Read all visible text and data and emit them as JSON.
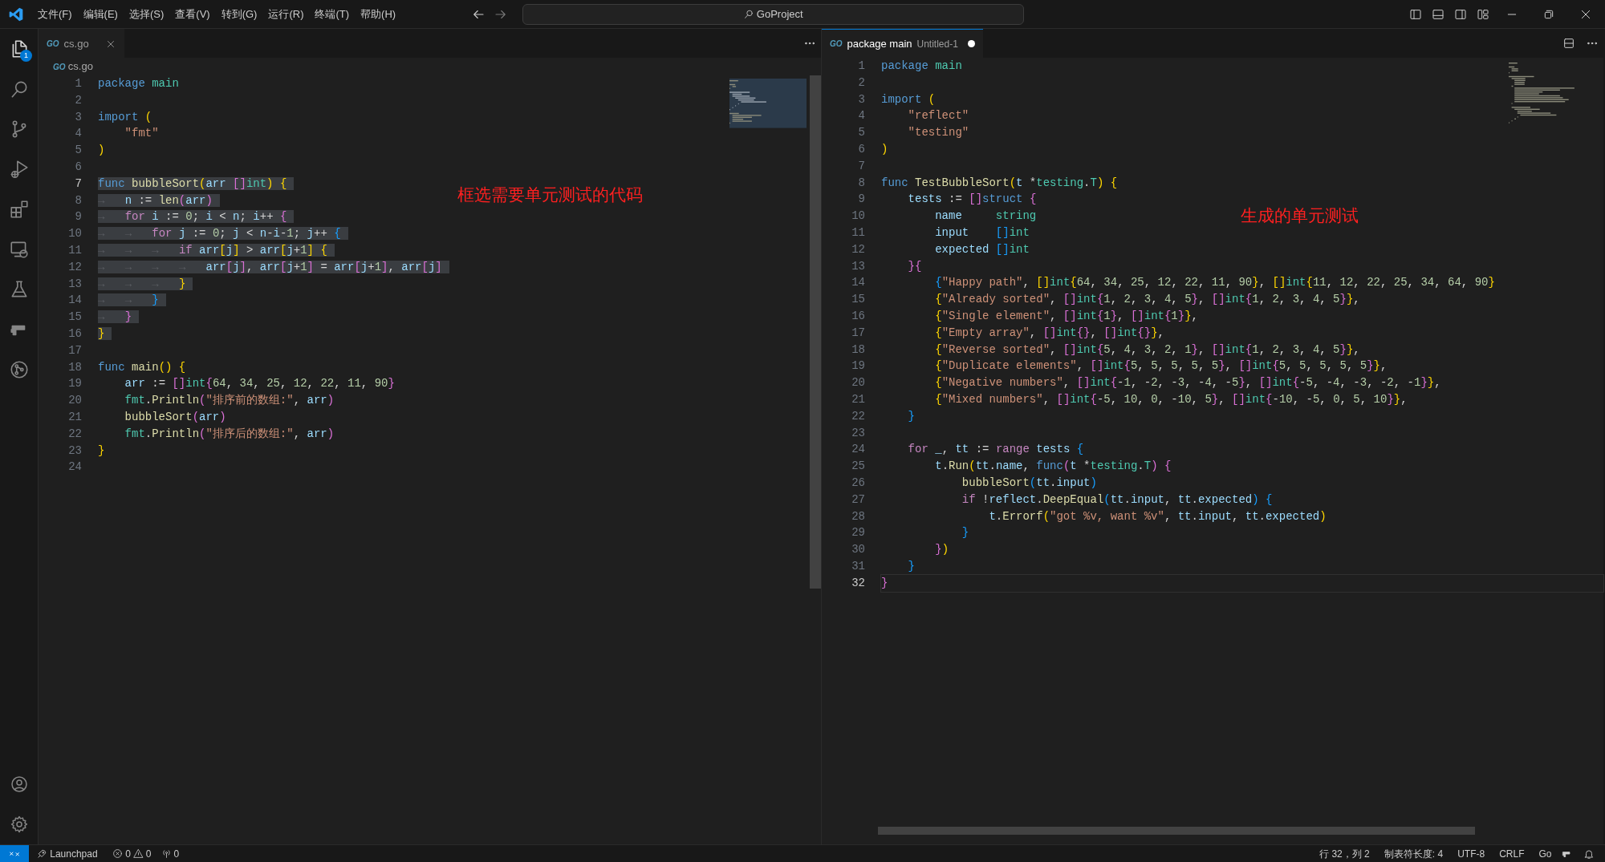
{
  "title_bar": {
    "menus": [
      "文件(F)",
      "编辑(E)",
      "选择(S)",
      "查看(V)",
      "转到(G)",
      "运行(R)",
      "终端(T)",
      "帮助(H)"
    ],
    "search": "GoProject"
  },
  "activity_bar": {
    "explorer_badge": "1"
  },
  "editors": [
    {
      "focused": false,
      "tab": {
        "icon": "GO",
        "label": "cs.go",
        "dirty": false
      },
      "breadcrumb": {
        "icon": "GO",
        "label": "cs.go"
      },
      "annotation": "框选需要单元测试的代码",
      "lines": [
        {
          "n": "1",
          "text": "package main",
          "selected": false,
          "current": false
        },
        {
          "n": "2",
          "current": false
        },
        {
          "n": "3",
          "text": "import (",
          "selected": false,
          "current": false
        },
        {
          "n": "4",
          "text": "    \"fmt\"",
          "selected": false,
          "current": false
        },
        {
          "n": "5",
          "text": ")",
          "selected": false,
          "current": false
        },
        {
          "n": "6",
          "current": false
        },
        {
          "n": "7",
          "text": "func bubbleSort(arr []int) {",
          "selected": true,
          "current": true
        },
        {
          "n": "8",
          "text": "→   n := len(arr)",
          "selected": true,
          "current": false
        },
        {
          "n": "9",
          "text": "→   for i := 0; i < n; i++ {",
          "selected": true,
          "current": false
        },
        {
          "n": "10",
          "text": "→   →   for j := 0; j < n-i-1; j++ {",
          "selected": true,
          "current": false
        },
        {
          "n": "11",
          "text": "→   →   →   if arr[j] > arr[j+1] {",
          "selected": true,
          "current": false
        },
        {
          "n": "12",
          "text": "→   →   →   →   arr[j], arr[j+1] = arr[j+1], arr[j]",
          "selected": true,
          "current": false
        },
        {
          "n": "13",
          "text": "→   →   →   }",
          "selected": true,
          "current": false
        },
        {
          "n": "14",
          "text": "→   →   }",
          "selected": true,
          "current": false
        },
        {
          "n": "15",
          "text": "→   }",
          "selected": true,
          "current": false
        },
        {
          "n": "16",
          "text": "}",
          "selected": true,
          "current": false
        },
        {
          "n": "17",
          "current": false
        },
        {
          "n": "18",
          "text": "func main() {",
          "selected": false,
          "current": false
        },
        {
          "n": "19",
          "text": "    arr := []int{64, 34, 25, 12, 22, 11, 90}",
          "selected": false,
          "current": false
        },
        {
          "n": "20",
          "text": "    fmt.Println(\"排序前的数组:\", arr)",
          "selected": false,
          "current": false
        },
        {
          "n": "21",
          "text": "    bubbleSort(arr)",
          "selected": false,
          "current": false
        },
        {
          "n": "22",
          "text": "    fmt.Println(\"排序后的数组:\", arr)",
          "selected": false,
          "current": false
        },
        {
          "n": "23",
          "text": "}",
          "selected": false,
          "current": false
        },
        {
          "n": "24",
          "current": false
        }
      ]
    },
    {
      "focused": true,
      "tab": {
        "icon": "GO",
        "label": "package main",
        "description": "Untitled-1",
        "dirty": true
      },
      "annotation": "生成的单元测试",
      "lines": [
        {
          "n": "1",
          "text": "package main",
          "selected": false,
          "current": false
        },
        {
          "n": "2",
          "current": false
        },
        {
          "n": "3",
          "text": "import (",
          "selected": false,
          "current": false
        },
        {
          "n": "4",
          "text": "    \"reflect\"",
          "selected": false,
          "current": false
        },
        {
          "n": "5",
          "text": "    \"testing\"",
          "selected": false,
          "current": false
        },
        {
          "n": "6",
          "text": ")",
          "selected": false,
          "current": false
        },
        {
          "n": "7",
          "current": false
        },
        {
          "n": "8",
          "text": "func TestBubbleSort(t *testing.T) {",
          "selected": false,
          "current": false
        },
        {
          "n": "9",
          "text": "    tests := []struct {",
          "selected": false,
          "current": false
        },
        {
          "n": "10",
          "text": "        name     string",
          "selected": false,
          "current": false
        },
        {
          "n": "11",
          "text": "        input    []int",
          "selected": false,
          "current": false
        },
        {
          "n": "12",
          "text": "        expected []int",
          "selected": false,
          "current": false
        },
        {
          "n": "13",
          "text": "    }{",
          "selected": false,
          "current": false
        },
        {
          "n": "14",
          "text": "        {\"Happy path\", []int{64, 34, 25, 12, 22, 11, 90}, []int{11, 12, 22, 25, 34, 64, 90}",
          "selected": false,
          "current": false
        },
        {
          "n": "15",
          "text": "        {\"Already sorted\", []int{1, 2, 3, 4, 5}, []int{1, 2, 3, 4, 5}},",
          "selected": false,
          "current": false
        },
        {
          "n": "16",
          "text": "        {\"Single element\", []int{1}, []int{1}},",
          "selected": false,
          "current": false
        },
        {
          "n": "17",
          "text": "        {\"Empty array\", []int{}, []int{}},",
          "selected": false,
          "current": false
        },
        {
          "n": "18",
          "text": "        {\"Reverse sorted\", []int{5, 4, 3, 2, 1}, []int{1, 2, 3, 4, 5}},",
          "selected": false,
          "current": false
        },
        {
          "n": "19",
          "text": "        {\"Duplicate elements\", []int{5, 5, 5, 5, 5}, []int{5, 5, 5, 5, 5}},",
          "selected": false,
          "current": false
        },
        {
          "n": "20",
          "text": "        {\"Negative numbers\", []int{-1, -2, -3, -4, -5}, []int{-5, -4, -3, -2, -1}},",
          "selected": false,
          "current": false
        },
        {
          "n": "21",
          "text": "        {\"Mixed numbers\", []int{-5, 10, 0, -10, 5}, []int{-10, -5, 0, 5, 10}},",
          "selected": false,
          "current": false
        },
        {
          "n": "22",
          "text": "    }",
          "selected": false,
          "current": false
        },
        {
          "n": "23",
          "current": false
        },
        {
          "n": "24",
          "text": "    for _, tt := range tests {",
          "selected": false,
          "current": false
        },
        {
          "n": "25",
          "text": "        t.Run(tt.name, func(t *testing.T) {",
          "selected": false,
          "current": false
        },
        {
          "n": "26",
          "text": "            bubbleSort(tt.input)",
          "selected": false,
          "current": false
        },
        {
          "n": "27",
          "text": "            if !reflect.DeepEqual(tt.input, tt.expected) {",
          "selected": false,
          "current": false
        },
        {
          "n": "28",
          "text": "                t.Errorf(\"got %v, want %v\", tt.input, tt.expected)",
          "selected": false,
          "current": false
        },
        {
          "n": "29",
          "text": "            }",
          "selected": false,
          "current": false
        },
        {
          "n": "30",
          "text": "        })",
          "selected": false,
          "current": false
        },
        {
          "n": "31",
          "text": "    }",
          "selected": false,
          "current": false
        },
        {
          "n": "32",
          "text": "}",
          "selected": false,
          "current": true
        }
      ]
    }
  ],
  "status_bar": {
    "launchpad": "Launchpad",
    "errors": "0",
    "warnings": "0",
    "ports": "0",
    "right": [
      "行 32，列 2",
      "制表符长度: 4",
      "UTF-8",
      "CRLF",
      "Go"
    ]
  }
}
